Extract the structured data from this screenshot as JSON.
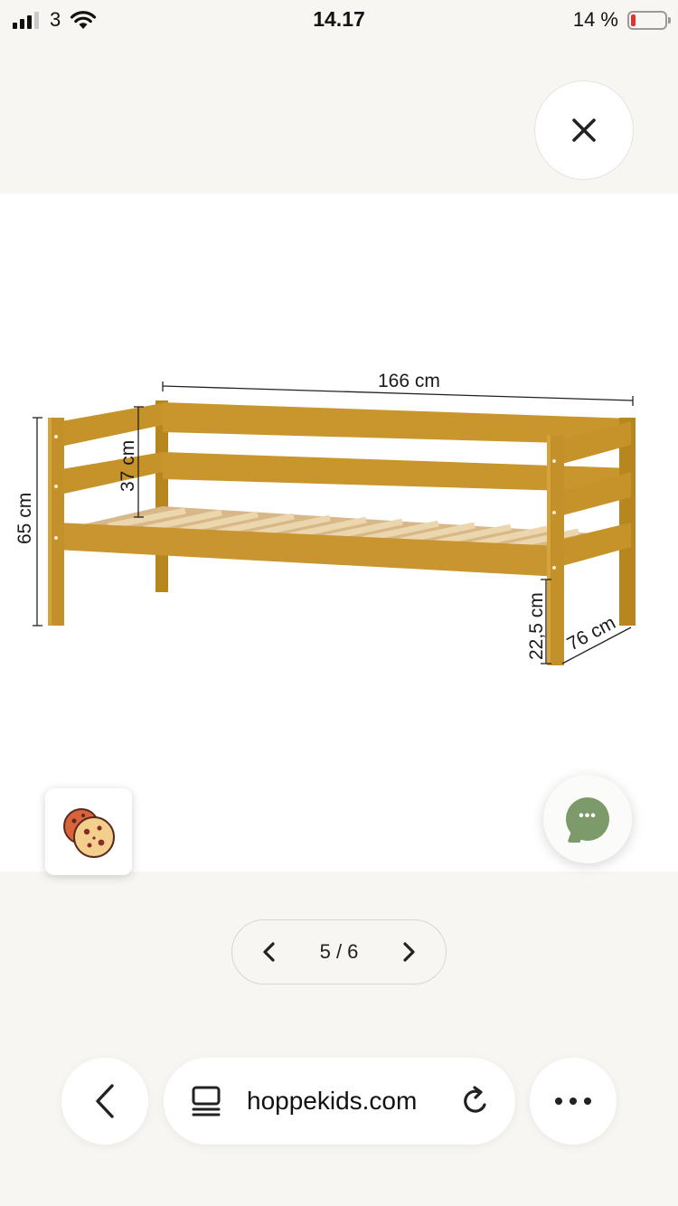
{
  "status_bar": {
    "carrier": "3",
    "time": "14.17",
    "battery_percent": "14 %",
    "battery_level": 0.14,
    "signal_bars_active": 3,
    "icons": [
      "signal-icon",
      "wifi-icon",
      "battery-icon"
    ]
  },
  "viewer": {
    "close_icon": "close-icon",
    "image": {
      "description_icon": "bed-dimension-drawing",
      "dimensions": {
        "length": "166 cm",
        "height_total": "65 cm",
        "rail_height": "37 cm",
        "leg_height": "22,5 cm",
        "depth": "76 cm"
      }
    },
    "cookie_icon": "cookie-icon",
    "chat_icon": "chat-icon",
    "pager": {
      "text": "5 / 6",
      "current": 5,
      "total": 6
    }
  },
  "browser": {
    "url": "hoppekids.com",
    "icons": [
      "back-icon",
      "reader-icon",
      "reload-icon",
      "more-icon"
    ]
  },
  "colors": {
    "background": "#f8f6f3",
    "wood": "#c4922a",
    "slat": "#e8cfa4",
    "chat": "#7c9a6a",
    "battery_low": "#e0342b"
  }
}
